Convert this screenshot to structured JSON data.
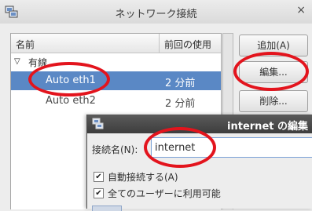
{
  "window": {
    "title": "ネットワーク接続",
    "close": "×"
  },
  "list": {
    "columns": {
      "name": "名前",
      "last_used": "前回の使用"
    },
    "group": {
      "expander": "▽",
      "label": "有線"
    },
    "rows": [
      {
        "name": "Auto eth1",
        "last_used": "2 分前"
      },
      {
        "name": "Auto eth2",
        "last_used": "2 分前"
      }
    ]
  },
  "buttons": {
    "add": "追加(A)",
    "edit": "編集...",
    "delete": "削除..."
  },
  "dialog": {
    "title": "internet の編集",
    "connection_name_label": "接続名(N):",
    "connection_name_value": "internet",
    "auto_connect_label": "自動接続する(A)",
    "all_users_label": "全てのユーザーに利用可能",
    "check_mark": "✔"
  },
  "colors": {
    "selection": "#5a88c5",
    "annotation": "#e3141d",
    "dialog_titlebar": "#3d3d3d"
  }
}
